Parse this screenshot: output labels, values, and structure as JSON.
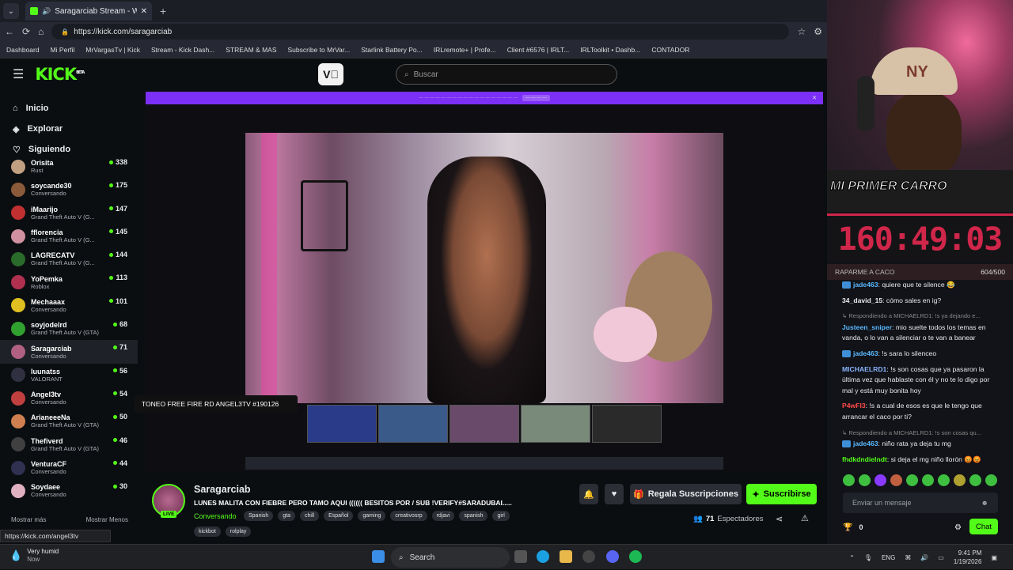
{
  "browser": {
    "tab_title": "Saragarciab Stream - Watch L",
    "url": "https://kick.com/saragarciab",
    "bookmarks": [
      "Dashboard",
      "Mi Perfil",
      "MrVargasTv | Kick",
      "Stream - Kick Dash...",
      "STREAM & MAS",
      "Subscribe to MrVar...",
      "Starlink Battery Po...",
      "IRLremote+ | Profe...",
      "Client #6576 | IRLT...",
      "IRLToolkit • Dashb...",
      "CONTADOR"
    ],
    "status_url": "https://kick.com/angel3tv"
  },
  "header": {
    "logo": "KICK",
    "logo_badge": "BETA",
    "search_placeholder": "Buscar"
  },
  "sidebar": {
    "nav": [
      {
        "label": "Inicio"
      },
      {
        "label": "Explorar"
      },
      {
        "label": "Siguiendo"
      }
    ],
    "channels": [
      {
        "name": "Orisita",
        "category": "Rust",
        "viewers": "338",
        "color": "#c0a080"
      },
      {
        "name": "soycande30",
        "category": "Conversando",
        "viewers": "175",
        "color": "#8a5a3a"
      },
      {
        "name": "iMaarijo",
        "category": "Grand Theft Auto V (G...",
        "viewers": "147",
        "color": "#c03030"
      },
      {
        "name": "fflorencia",
        "category": "Grand Theft Auto V (G...",
        "viewers": "145",
        "color": "#d090a0"
      },
      {
        "name": "LAGRECATV",
        "category": "Grand Theft Auto V (G...",
        "viewers": "144",
        "color": "#2a6a2a"
      },
      {
        "name": "YoPemka",
        "category": "Roblox",
        "viewers": "113",
        "color": "#b03050"
      },
      {
        "name": "Mechaaax",
        "category": "Conversando",
        "viewers": "101",
        "color": "#e0c020"
      },
      {
        "name": "soyjodelrd",
        "category": "Grand Theft Auto V (GTA)",
        "viewers": "68",
        "color": "#30a030"
      },
      {
        "name": "Saragarciab",
        "category": "Conversando",
        "viewers": "71",
        "color": "#b06080"
      },
      {
        "name": "luunatss",
        "category": "VALORANT",
        "viewers": "56",
        "color": "#303040"
      },
      {
        "name": "Angel3tv",
        "category": "Conversando",
        "viewers": "54",
        "color": "#c04040"
      },
      {
        "name": "ArianeeeNa",
        "category": "Grand Theft Auto V (GTA)",
        "viewers": "50",
        "color": "#d08050"
      },
      {
        "name": "Thefiverd",
        "category": "Grand Theft Auto V (GTA)",
        "viewers": "46",
        "color": "#404040"
      },
      {
        "name": "VenturaCF",
        "category": "Conversando",
        "viewers": "44",
        "color": "#303050"
      },
      {
        "name": "Soydaee",
        "category": "Conversando",
        "viewers": "30",
        "color": "#e0b0c0"
      }
    ],
    "show_more": "Mostrar más",
    "show_less": "Mostrar Menos"
  },
  "player": {
    "tooltip": "TONEO FREE FIRE RD ANGEL3TV #190126"
  },
  "stream": {
    "name": "Saragarciab",
    "live_label": "LIVE",
    "title": "LUNES MALITA CON FIEBRE PERO TAMO AQUI (((((( BESITOS POR / SUB !VERIFY#SARADUBAI.....",
    "category": "Conversando",
    "tags": [
      "Spanish",
      "gta",
      "chill",
      "Español",
      "gaming",
      "creativosrp",
      "rdjavi",
      "spanish",
      "girl"
    ],
    "tags_row2": [
      "kickbot",
      "rolplay"
    ],
    "gift_label": "Regala Suscripciones",
    "subscribe_label": "Suscribirse",
    "viewers": "71",
    "viewers_label": "Espectadores"
  },
  "overlay": {
    "caption": "MI PRIMER CARRO",
    "timer": "160:49:03",
    "goal_label": "RAPARME A CACO",
    "goal_value": "604/500"
  },
  "chat": {
    "messages": [
      {
        "reply": "",
        "user": "jade463",
        "user_color": "#5ab8ff",
        "badge": true,
        "text": "quiere que te silence 😂"
      },
      {
        "reply": "",
        "user": "34_david_15",
        "user_color": "#e8eaed",
        "badge": false,
        "text": "cómo sales en ig?"
      },
      {
        "reply": "Respondiendo a MICHAELRD1: !s ya dejando e...",
        "user": "Justeen_sniper",
        "user_color": "#5ab8ff",
        "badge": false,
        "text": "mio suelte todos los temas en vanda, o lo van a silenciar o te van a banear"
      },
      {
        "reply": "",
        "user": "jade463",
        "user_color": "#5ab8ff",
        "badge": true,
        "text": "!s sara lo silenceo"
      },
      {
        "reply": "",
        "user": "MICHAELRD1",
        "user_color": "#8ab4ff",
        "badge": false,
        "text": "!s son cosas que ya pasaron la última vez que hablaste con él y no te lo digo por mal y está muy bonita hoy"
      },
      {
        "reply": "",
        "user": "P4wFl3",
        "user_color": "#ff4a4a",
        "badge": false,
        "text": "!s a cual de esos es que le tengo que arrancar el caco por ti?"
      },
      {
        "reply": "Respondiendo a MICHAELRD1: !s son cosas qu...",
        "user": "jade463",
        "user_color": "#5ab8ff",
        "badge": true,
        "text": "niño rata ya deja tu mg"
      },
      {
        "reply": "",
        "user": "fhdkdndieIndt",
        "user_color": "#53fc18",
        "badge": false,
        "text": "si deja el mg niño llorón 😡😡"
      }
    ],
    "input_placeholder": "Enviar un mensaje",
    "points": "0",
    "send_label": "Chat"
  },
  "taskbar": {
    "weather_title": "Very humid",
    "weather_sub": "Now",
    "search_label": "Search",
    "lang": "ENG",
    "time": "9:41 PM",
    "date": "1/19/2026"
  }
}
